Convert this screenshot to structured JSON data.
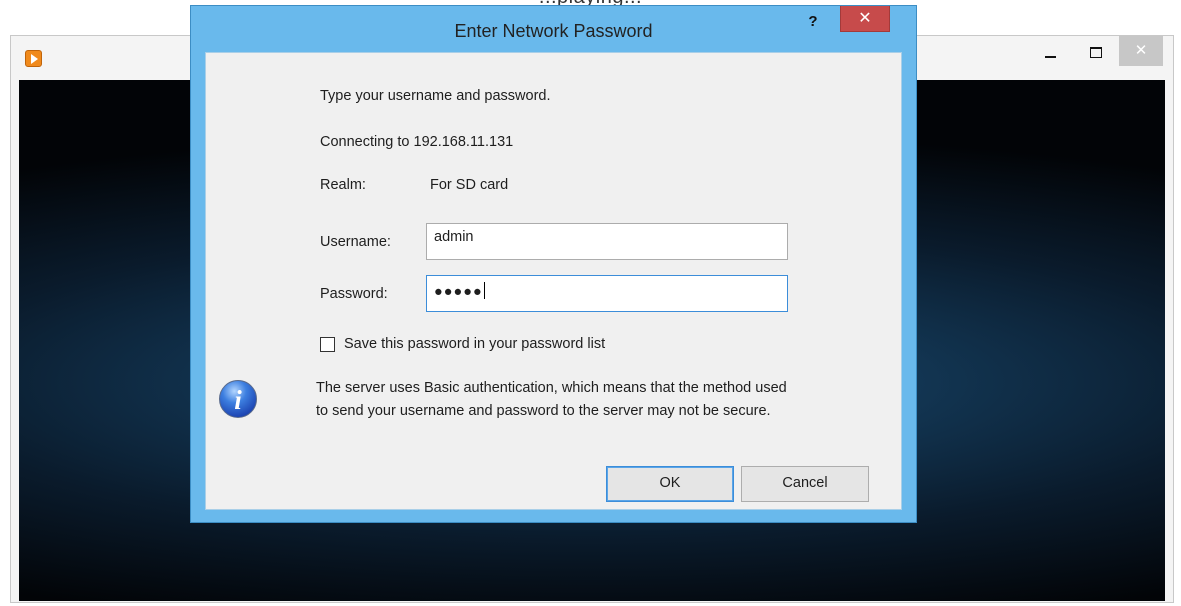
{
  "background": {
    "page_caption": "...playing...",
    "player": {
      "minimize_symbol": "–",
      "maximize_symbol": "□",
      "close_symbol": "✕"
    }
  },
  "dialog": {
    "title": "Enter Network Password",
    "help_label": "?",
    "close_label": "✕",
    "prompt": "Type your username and password.",
    "connecting": "Connecting to 192.168.11.131",
    "realm_label": "Realm:",
    "realm_value": "For SD card",
    "username_label": "Username:",
    "username_value": "admin",
    "password_label": "Password:",
    "password_masked": "●●●●●",
    "save_password_label": "Save this password in your password list",
    "save_password_checked": false,
    "info_line_1": "The server uses Basic authentication, which means that the method used",
    "info_line_2": "to send your username and password to the server may not be secure.",
    "ok_label": "OK",
    "cancel_label": "Cancel",
    "icons": {
      "info": "info-icon",
      "app": "player-logo-icon"
    },
    "colors": {
      "title_bar": "#69b9ec",
      "close_button": "#c74b4b",
      "focus_border": "#3c8dd9"
    }
  }
}
